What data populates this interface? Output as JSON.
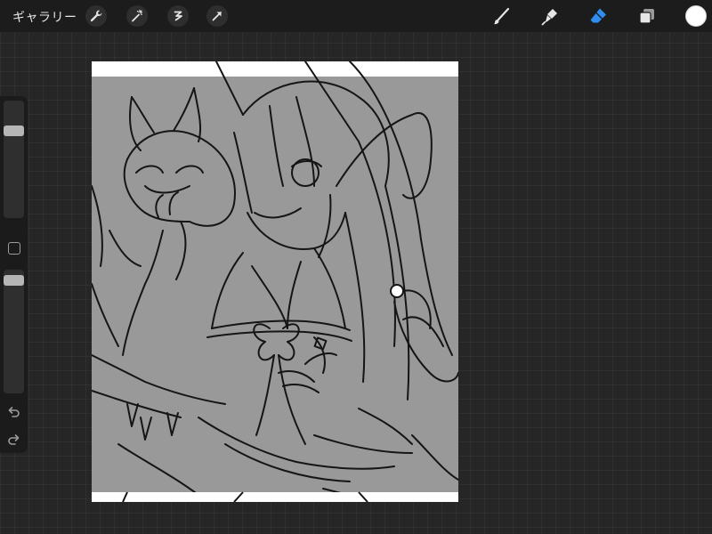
{
  "topbar": {
    "gallery_label": "ギャラリー",
    "left_tools": [
      {
        "icon": "wrench-icon",
        "name": "actions"
      },
      {
        "icon": "magic-wand-icon",
        "name": "adjustments"
      },
      {
        "icon": "selection-s-icon",
        "name": "selection"
      },
      {
        "icon": "arrow-cursor-icon",
        "name": "transform"
      }
    ],
    "right_tools": [
      {
        "icon": "brush-icon",
        "name": "paint",
        "active": false
      },
      {
        "icon": "smudge-icon",
        "name": "smudge",
        "active": false
      },
      {
        "icon": "eraser-icon",
        "name": "eraser",
        "active": true
      },
      {
        "icon": "layers-icon",
        "name": "layers",
        "active": false
      }
    ],
    "current_color": "#ffffff",
    "active_color": "#2f8cf0",
    "icon_color": "#e6e6e6"
  },
  "sidebar": {
    "brush_size_level": 0.77,
    "opacity_level": 0.95,
    "undo_icon": "undo-icon",
    "redo_icon": "redo-icon",
    "modify_icon": "square-icon"
  },
  "canvas": {
    "background": "#ffffff",
    "fill_color": "#999999",
    "line_color": "#151515"
  }
}
